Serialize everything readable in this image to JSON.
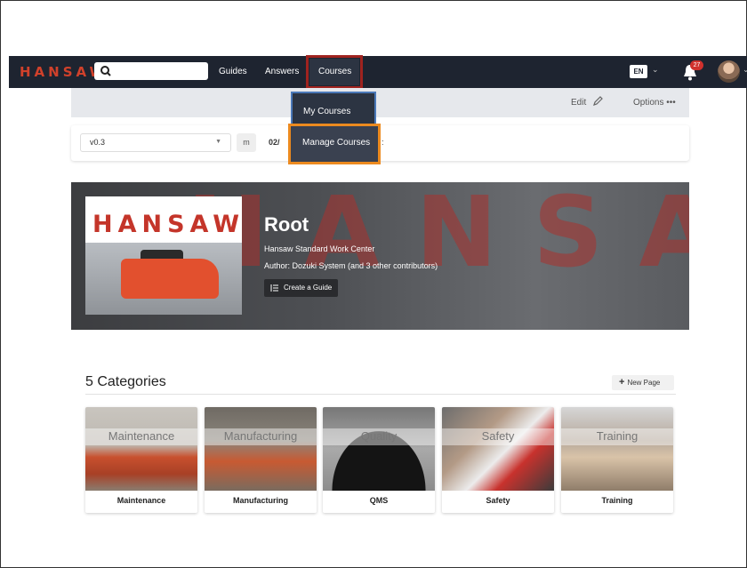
{
  "nav": {
    "logo": "HANSAW",
    "links": [
      "Guides",
      "Answers",
      "Courses"
    ],
    "lang": "EN",
    "notifications": "27"
  },
  "toolbar": {
    "edit_label": "Edit",
    "options_label": "Options •••"
  },
  "version": {
    "selected": "v0.3",
    "m_label": "m",
    "date_fragment": "02/",
    "colon_fragment": ":"
  },
  "dropdown": {
    "items": [
      "My Courses",
      "Manage Courses"
    ]
  },
  "hero": {
    "bg_text": "HANSAW",
    "image_text": "HANSAW",
    "title": "Root",
    "subtitle": "Hansaw Standard Work Center",
    "author": "Author: Dozuki System (and 3 other contributors)",
    "create_label": "Create a Guide"
  },
  "categories": {
    "heading": "5 Categories",
    "new_page_label": "New Page",
    "items": [
      {
        "overlay": "Maintenance",
        "label": "Maintenance"
      },
      {
        "overlay": "Manufacturing",
        "label": "Manufacturing"
      },
      {
        "overlay": "Quality",
        "label": "QMS"
      },
      {
        "overlay": "Safety",
        "label": "Safety"
      },
      {
        "overlay": "Training",
        "label": "Training"
      }
    ]
  },
  "colors": {
    "nav_bg": "#1e2430",
    "courses_highlight": "#a0231f",
    "manage_highlight": "#ec8a1f",
    "brand_red": "#c4352a"
  }
}
